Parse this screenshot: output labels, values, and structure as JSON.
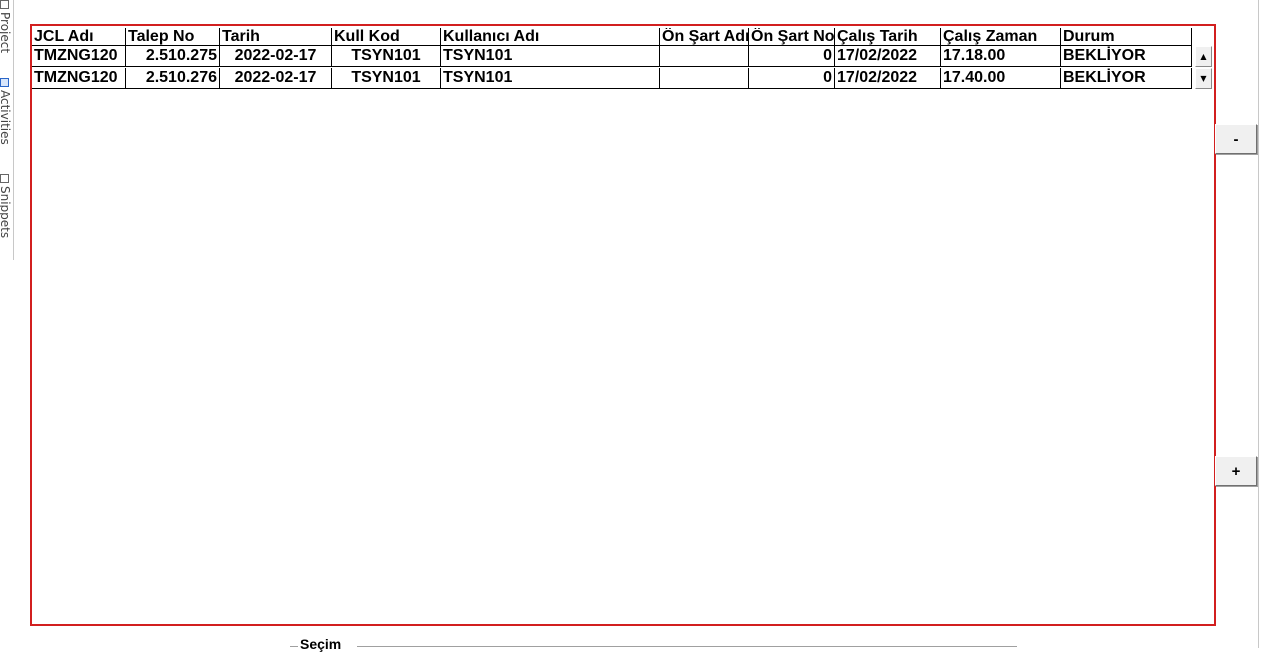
{
  "side_panel": {
    "tabs": [
      {
        "label": "Project",
        "icon": "project-icon"
      },
      {
        "label": "Activities",
        "icon": "activities-icon"
      },
      {
        "label": "Snippets",
        "icon": "snippets-icon"
      }
    ]
  },
  "grid": {
    "columns": [
      "JCL Adı",
      "Talep No",
      "Tarih",
      "Kull Kod",
      "Kullanıcı Adı",
      "Ön Şart Adı",
      "Ön Şart No",
      "Çalış Tarih",
      "Çalış Zaman",
      "Durum"
    ],
    "rows": [
      [
        "TMZNG120",
        "2.510.275",
        "2022-02-17",
        "TSYN101",
        "TSYN101",
        "",
        "0",
        "17/02/2022",
        "17.18.00",
        "BEKLİYOR"
      ],
      [
        "TMZNG120",
        "2.510.276",
        "2022-02-17",
        "TSYN101",
        "TSYN101",
        "",
        "0",
        "17/02/2022",
        "17.40.00",
        "BEKLİYOR"
      ]
    ],
    "border_color": "#d21f1f"
  },
  "buttons": {
    "minus_label": "-",
    "plus_label": "+"
  },
  "selection_group": {
    "label": "Seçim"
  }
}
